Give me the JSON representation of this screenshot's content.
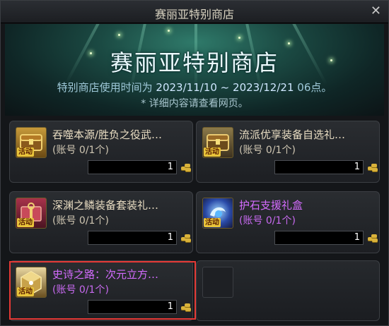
{
  "window": {
    "title": "赛丽亚特别商店",
    "close_symbol": "✕"
  },
  "banner": {
    "title": "赛丽亚特别商店",
    "period_prefix": "特别商店使用时间为",
    "start_date": "2023/11/10",
    "separator": "~",
    "end_date": "2023/12/21",
    "end_suffix": "06点。",
    "note": "* 详细内容请查看网页。"
  },
  "items": [
    {
      "name": "吞噬本源/胜负之役武…",
      "limit": "(账号 0/1个)",
      "quantity": "1",
      "tag": "活动",
      "style": "normal",
      "icon": "treasure-chest-icon"
    },
    {
      "name": "流派优享装备自选礼…",
      "limit": "(账号 0/1个)",
      "quantity": "1",
      "tag": "活动",
      "style": "normal",
      "icon": "treasure-chest-icon"
    },
    {
      "name": "深渊之鳞装备套装礼…",
      "limit": "(账号 0/1个)",
      "quantity": "1",
      "tag": "活动",
      "style": "normal",
      "icon": "gift-box-icon"
    },
    {
      "name": "护石支援礼盒",
      "limit": "(账号 0/1个)",
      "quantity": "1",
      "tag": "活动",
      "style": "purple",
      "icon": "talisman-box-icon"
    },
    {
      "name": "史诗之路：次元立方…",
      "limit": "(账号 0/1个)",
      "quantity": "1",
      "tag": "活动",
      "style": "purple",
      "icon": "epic-cube-icon"
    }
  ],
  "colors": {
    "purple_text": "#d46cff",
    "highlight": "#e53935",
    "tag_bg": "#e8c43a"
  }
}
